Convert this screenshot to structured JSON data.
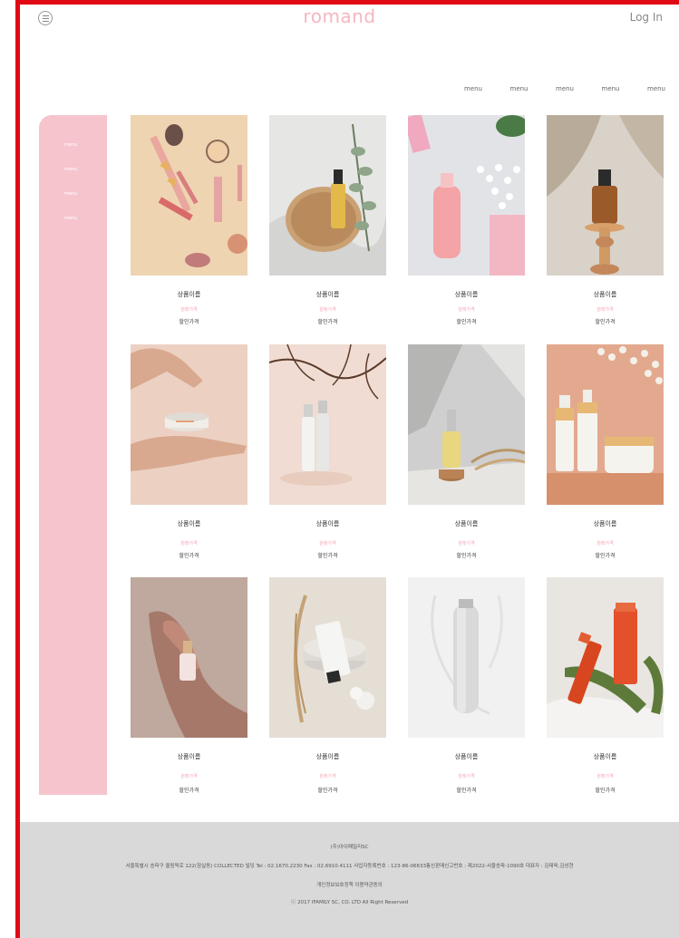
{
  "header": {
    "brand": "romand",
    "login": "Log In"
  },
  "nav": {
    "items": [
      "menu",
      "menu",
      "menu",
      "menu",
      "menu"
    ]
  },
  "sidebar": {
    "items": [
      "menu",
      "menu",
      "menu",
      "menu"
    ]
  },
  "products": [
    {
      "name": "상품이름",
      "original_price": "원래가격",
      "sale_price": "할인가격"
    },
    {
      "name": "상품이름",
      "original_price": "원래가격",
      "sale_price": "할인가격"
    },
    {
      "name": "상품이름",
      "original_price": "원래가격",
      "sale_price": "할인가격"
    },
    {
      "name": "상품이름",
      "original_price": "원래가격",
      "sale_price": "할인가격"
    },
    {
      "name": "상품이름",
      "original_price": "원래가격",
      "sale_price": "할인가격"
    },
    {
      "name": "상품이름",
      "original_price": "원래가격",
      "sale_price": "할인가격"
    },
    {
      "name": "상품이름",
      "original_price": "원래가격",
      "sale_price": "할인가격"
    },
    {
      "name": "상품이름",
      "original_price": "원래가격",
      "sale_price": "할인가격"
    },
    {
      "name": "상품이름",
      "original_price": "원래가격",
      "sale_price": "할인가격"
    },
    {
      "name": "상품이름",
      "original_price": "원래가격",
      "sale_price": "할인가격"
    },
    {
      "name": "상품이름",
      "original_price": "원래가격",
      "sale_price": "할인가격"
    },
    {
      "name": "상품이름",
      "original_price": "원래가격",
      "sale_price": "할인가격"
    }
  ],
  "footer": {
    "company": "(주)아이패밀리SC",
    "info": "서울특별시 송파구 올림픽로 122(잠실동) COLLECTED 빌딩 Tel : 02.1670.2230 Fax : 02.6910.4111 사업자등록번호 : 123-86-06633통신판매신고번호 : 제2022-서울송파-1090호 대표자 : 김태욱,김성현",
    "privacy": "개인정보보호정책 이용약관동의",
    "copyright": "ⓒ 2017 IFAMILY SC, CO. LTD All Right Reserved"
  },
  "colors": {
    "frame": "#e10a14",
    "brand": "#f5b6c1",
    "sidebar": "#f6c4cd",
    "footer_bg": "#d9d9d9",
    "original_price": "#f4a5b4"
  }
}
